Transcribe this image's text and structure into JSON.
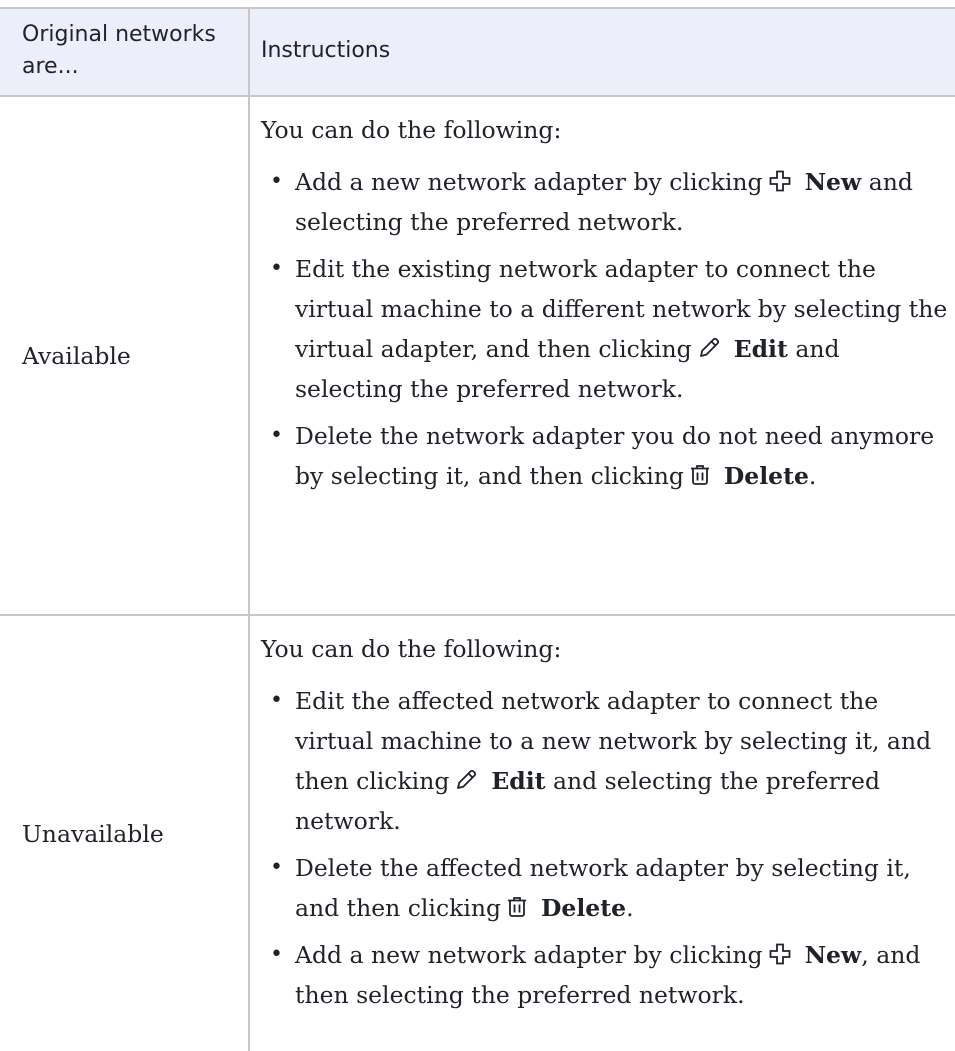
{
  "table": {
    "headers": {
      "col1": "Original networks are...",
      "col2": "Instructions"
    },
    "rows": [
      {
        "state": "Available",
        "intro": "You can do the following:",
        "items": [
          {
            "before": "Add a new network adapter by clicking",
            "icon": "plus-icon",
            "action": "New",
            "after": " and selecting the preferred network."
          },
          {
            "before": "Edit the existing network adapter to connect the virtual machine to a different network by selecting the virtual adapter, and then clicking",
            "icon": "pencil-icon",
            "action": "Edit",
            "after": " and selecting the preferred network."
          },
          {
            "before": "Delete the network adapter you do not need anymore by selecting it, and then clicking",
            "icon": "trash-icon",
            "action": "Delete",
            "after": "."
          }
        ]
      },
      {
        "state": "Unavailable",
        "intro": "You can do the following:",
        "items": [
          {
            "before": "Edit the affected network adapter to connect the virtual machine to a new network by selecting it, and then clicking",
            "icon": "pencil-icon",
            "action": "Edit",
            "after": " and selecting the preferred network."
          },
          {
            "before": "Delete the affected network adapter by selecting it, and then clicking",
            "icon": "trash-icon",
            "action": "Delete",
            "after": "."
          },
          {
            "before": "Add a new network adapter by clicking",
            "icon": "plus-icon",
            "action": "New",
            "after": ", and then selecting the preferred network."
          }
        ]
      }
    ]
  }
}
